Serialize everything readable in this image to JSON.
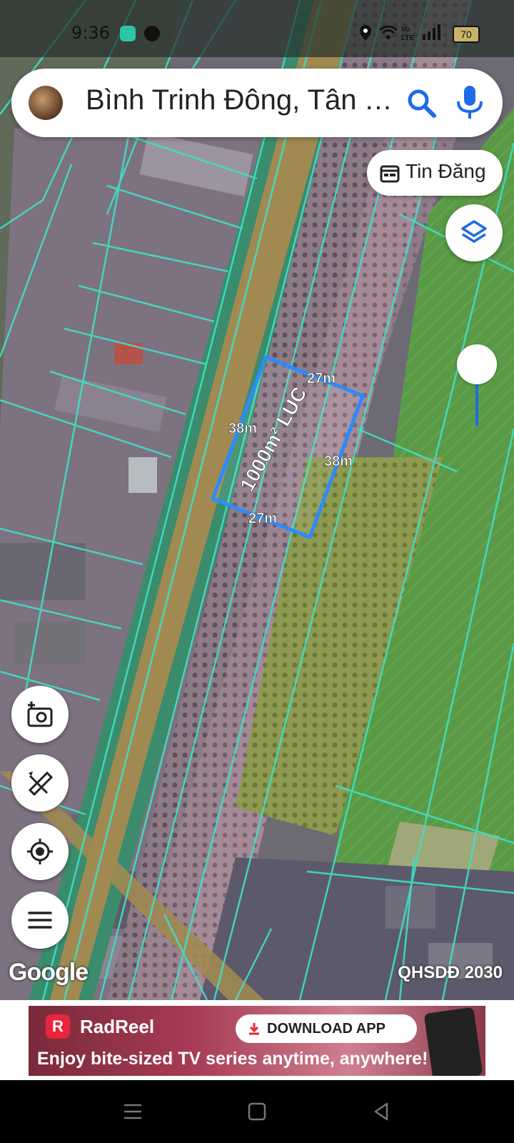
{
  "status_bar": {
    "time": "9:36",
    "battery": "70"
  },
  "search": {
    "query": "Bình Trinh Đông, Tân T..."
  },
  "chip": {
    "label": "Tin Đăng"
  },
  "map": {
    "parcel_label": "1000m² LUC",
    "edge_top": "27m",
    "edge_left": "38m",
    "edge_right": "38m",
    "edge_bottom": "27m",
    "attribution": "Google",
    "plan_label": "QHSDĐ 2030"
  },
  "ad": {
    "brand": "RadReel",
    "download": "DOWNLOAD APP",
    "tagline": "Enjoy bite-sized TV series anytime, anywhere!"
  },
  "colors": {
    "accent": "#1e6be6",
    "parcel": "#2b8bff",
    "cadastral": "#3fe0c8"
  },
  "icons": [
    "search-icon",
    "mic-icon",
    "calendar-icon",
    "layers-icon",
    "camera-add-icon",
    "ruler-icon",
    "my-location-icon",
    "menu-icon"
  ]
}
